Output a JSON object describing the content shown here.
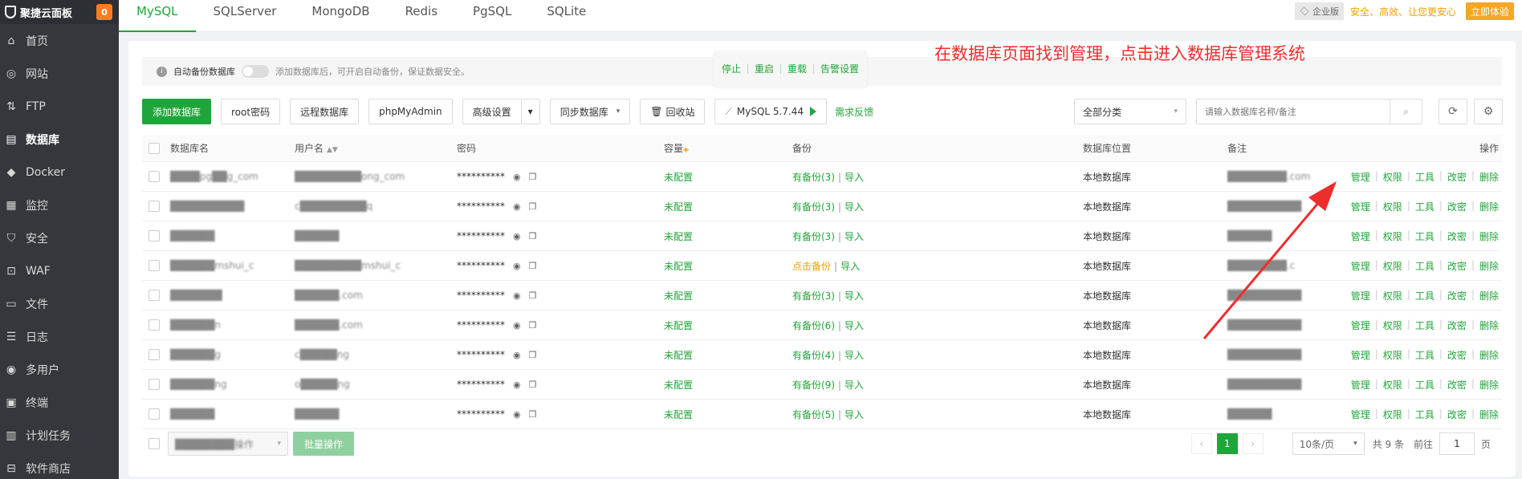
{
  "sidebar": {
    "brand": "聚捷云面板",
    "badge": "0",
    "items": [
      {
        "label": "首页",
        "icon": "home-icon"
      },
      {
        "label": "网站",
        "icon": "globe-icon"
      },
      {
        "label": "FTP",
        "icon": "ftp-icon"
      },
      {
        "label": "数据库",
        "icon": "database-icon"
      },
      {
        "label": "Docker",
        "icon": "docker-icon"
      },
      {
        "label": "监控",
        "icon": "monitor-icon"
      },
      {
        "label": "安全",
        "icon": "shield-icon"
      },
      {
        "label": "WAF",
        "icon": "firewall-icon"
      },
      {
        "label": "文件",
        "icon": "folder-icon"
      },
      {
        "label": "日志",
        "icon": "log-icon"
      },
      {
        "label": "多用户",
        "icon": "users-icon"
      },
      {
        "label": "终端",
        "icon": "terminal-icon"
      },
      {
        "label": "计划任务",
        "icon": "calendar-icon"
      },
      {
        "label": "软件商店",
        "icon": "store-icon"
      }
    ]
  },
  "topbar": {
    "tabs": [
      "MySQL",
      "SQLServer",
      "MongoDB",
      "Redis",
      "PgSQL",
      "SQLite"
    ],
    "enterprise": "企业版",
    "slogan": "安全、高效、让您更安心",
    "trial": "立即体验"
  },
  "notice": {
    "label": "自动备份数据库",
    "hint": "添加数据库后，可开启自动备份，保证数据安全。"
  },
  "mysql_popup": [
    "停止",
    "重启",
    "重载",
    "告警设置"
  ],
  "annotation": "在数据库页面找到管理，点击进入数据库管理系统",
  "toolbar": {
    "add": "添加数据库",
    "root_pwd": "root密码",
    "remote": "远程数据库",
    "pma": "phpMyAdmin",
    "advanced": "高级设置",
    "sync": "同步数据库",
    "recycle": "回收站",
    "version": "MySQL 5.7.44",
    "feedback": "需求反馈"
  },
  "filters": {
    "category": "全部分类",
    "search_placeholder": "请输入数据库名称/备注"
  },
  "table": {
    "headers": {
      "name": "数据库名",
      "user": "用户名",
      "pwd": "密码",
      "cap": "容量",
      "bak": "备份",
      "loc": "数据库位置",
      "note": "备注",
      "ops": "操作"
    },
    "rows": [
      {
        "name": "████pg██g_com",
        "user": "█████████ong_com",
        "pwd": "**********",
        "cap": "未配置",
        "bak": "有备份(3)",
        "import": "导入",
        "loc": "本地数据库",
        "note": "████████.com"
      },
      {
        "name": "██████████",
        "user": "c█████████q",
        "pwd": "**********",
        "cap": "未配置",
        "bak": "有备份(3)",
        "import": "导入",
        "loc": "本地数据库",
        "note": "██████████"
      },
      {
        "name": "██████",
        "user": "██████",
        "pwd": "**********",
        "cap": "未配置",
        "bak": "有备份(3)",
        "import": "导入",
        "loc": "本地数据库",
        "note": "██████"
      },
      {
        "name": "██████mshui_c",
        "user": "█████████mshui_c",
        "pwd": "**********",
        "cap": "未配置",
        "bak": "点击备份",
        "import": "导入",
        "loc": "本地数据库",
        "note": "████████.c"
      },
      {
        "name": "███████",
        "user": "██████.com",
        "pwd": "**********",
        "cap": "未配置",
        "bak": "有备份(3)",
        "import": "导入",
        "loc": "本地数据库",
        "note": "██████████"
      },
      {
        "name": "██████n",
        "user": "██████.com",
        "pwd": "**********",
        "cap": "未配置",
        "bak": "有备份(6)",
        "import": "导入",
        "loc": "本地数据库",
        "note": "██████████"
      },
      {
        "name": "██████g",
        "user": "c█████ng",
        "pwd": "**********",
        "cap": "未配置",
        "bak": "有备份(4)",
        "import": "导入",
        "loc": "本地数据库",
        "note": "██████████"
      },
      {
        "name": "██████ng",
        "user": "o█████ng",
        "pwd": "**********",
        "cap": "未配置",
        "bak": "有备份(9)",
        "import": "导入",
        "loc": "本地数据库",
        "note": "██████████"
      },
      {
        "name": "██████",
        "user": "██████",
        "pwd": "**********",
        "cap": "未配置",
        "bak": "有备份(5)",
        "import": "导入",
        "loc": "本地数据库",
        "note": "██████"
      }
    ],
    "ops": [
      "管理",
      "权限",
      "工具",
      "改密",
      "删除"
    ]
  },
  "footer": {
    "batch_select": "████████操作",
    "batch_btn": "批量操作",
    "page": "1",
    "page_size": "10条/页",
    "total": "共 9 条",
    "goto": "前往",
    "goto_val": "1",
    "page_unit": "页"
  },
  "colors": {
    "accent": "#20a53a",
    "annotation": "#ee2d2d",
    "warning": "#f0a000"
  }
}
